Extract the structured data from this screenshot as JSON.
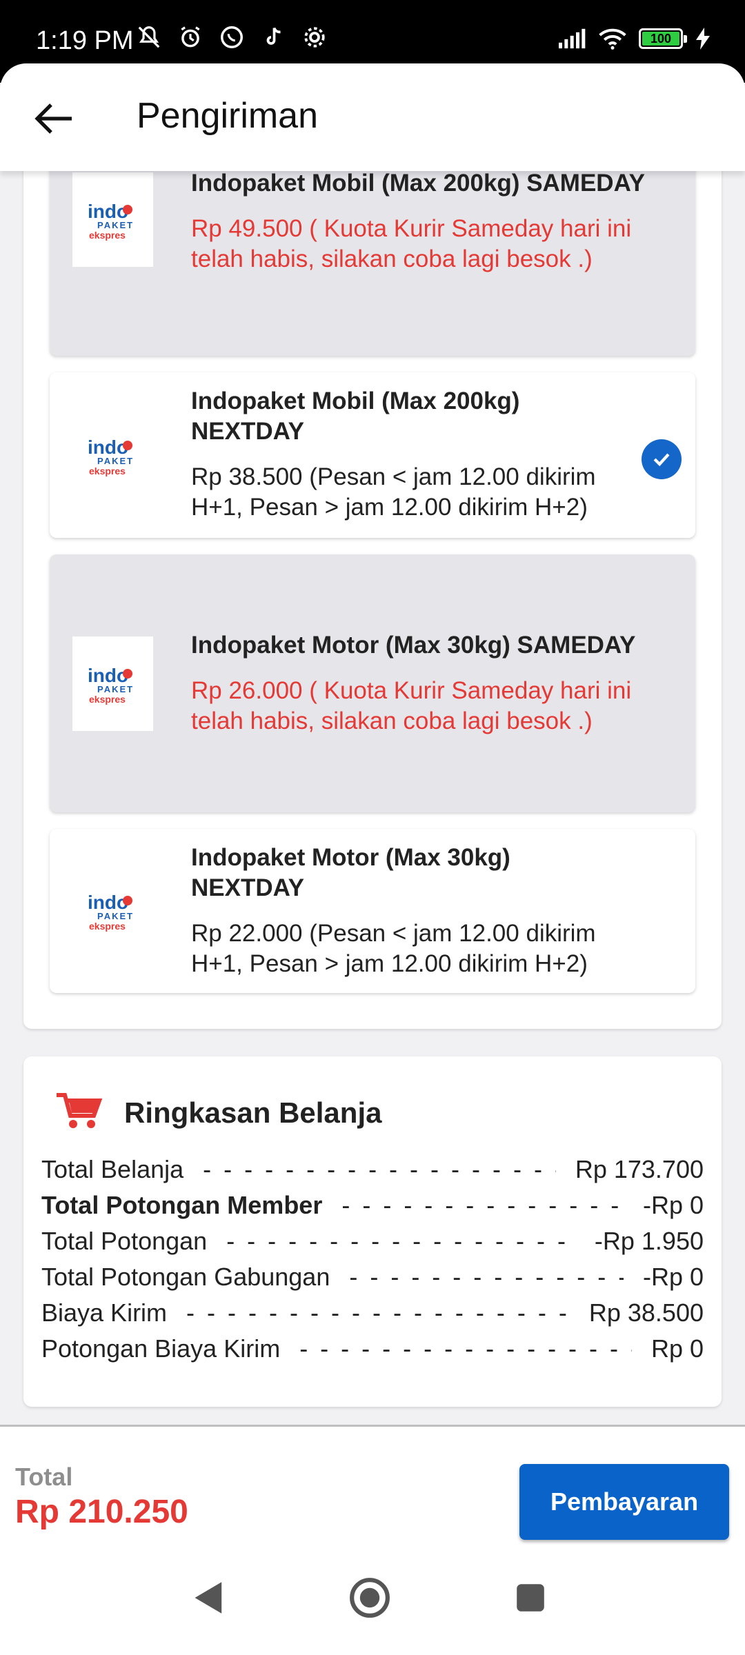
{
  "status_bar": {
    "time": "1:19 PM",
    "battery": "100",
    "icons_left": [
      "muted-icon",
      "alarm-icon",
      "whatsapp-icon",
      "tiktok-icon",
      "settings-icon"
    ],
    "icons_right": [
      "signal-icon",
      "wifi-icon",
      "battery-icon",
      "charging-icon"
    ]
  },
  "header": {
    "title": "Pengiriman"
  },
  "shipping_options": [
    {
      "title": "Indopaket Mobil (Max 200kg) SAMEDAY",
      "description": "Rp 49.500 ( Kuota Kurir Sameday hari ini telah habis, silakan coba lagi besok .)",
      "available": false,
      "selected": false
    },
    {
      "title": "Indopaket Mobil (Max 200kg) NEXTDAY",
      "description": "Rp 38.500 (Pesan < jam 12.00 dikirim H+1, Pesan > jam 12.00 dikirim H+2)",
      "available": true,
      "selected": true
    },
    {
      "title": "Indopaket Motor (Max 30kg) SAMEDAY",
      "description": "Rp 26.000 ( Kuota Kurir Sameday hari ini telah habis, silakan coba lagi besok .)",
      "available": false,
      "selected": false
    },
    {
      "title": "Indopaket Motor (Max 30kg) NEXTDAY",
      "description": "Rp 22.000 (Pesan < jam 12.00 dikirim H+1, Pesan > jam 12.00 dikirim H+2)",
      "available": true,
      "selected": false
    }
  ],
  "logo": {
    "line1": "indo",
    "line2": "PAKET",
    "line3": "ekspres"
  },
  "summary": {
    "title": "Ringkasan Belanja",
    "rows": [
      {
        "label": "Total Belanja",
        "value": "Rp 173.700",
        "bold": false
      },
      {
        "label": "Total Potongan Member",
        "value": "-Rp 0",
        "bold": true
      },
      {
        "label": "Total Potongan",
        "value": "-Rp 1.950",
        "bold": false
      },
      {
        "label": "Total Potongan Gabungan",
        "value": "-Rp 0",
        "bold": false
      },
      {
        "label": "Biaya Kirim",
        "value": "Rp 38.500",
        "bold": false
      },
      {
        "label": "Potongan Biaya Kirim",
        "value": "Rp 0",
        "bold": false
      }
    ]
  },
  "footer": {
    "total_label": "Total",
    "total_value": "Rp 210.250",
    "pay_button": "Pembayaran"
  },
  "colors": {
    "primary": "#0a63c9",
    "danger": "#e53935",
    "disabled_card": "#e5e5ea"
  }
}
